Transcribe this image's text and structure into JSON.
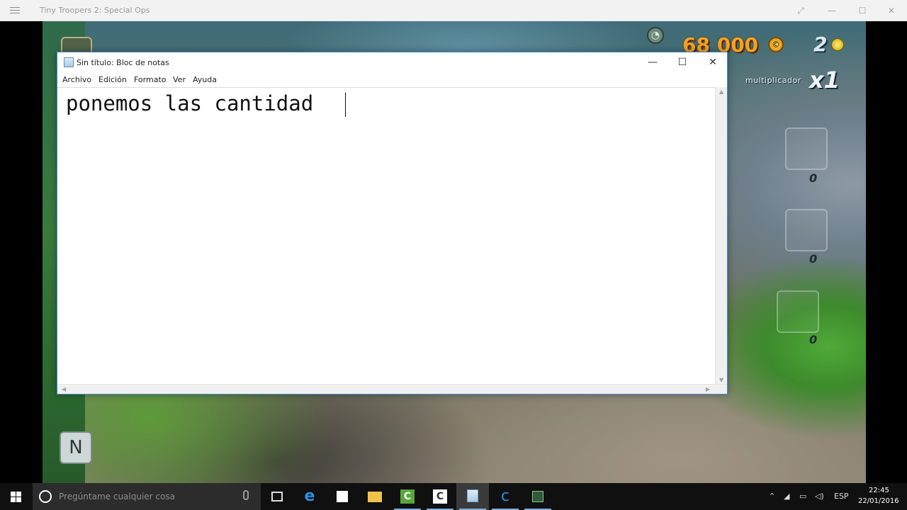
{
  "app_window": {
    "title": "Tiny Troopers 2: Special Ops",
    "minimize": "—",
    "maximize": "☐",
    "close": "✕"
  },
  "game_hud": {
    "money": "68 000",
    "coin_symbol": "©",
    "count": "2",
    "multiplier_label": "multiplicador",
    "multiplier_value": "x1",
    "slot_counts": [
      "0",
      "0",
      "0"
    ],
    "compass_symbol": "N"
  },
  "notepad": {
    "title": "Sin título: Bloc de notas",
    "menu": [
      "Archivo",
      "Edición",
      "Formato",
      "Ver",
      "Ayuda"
    ],
    "text": "ponemos las cantidad ",
    "minimize": "—",
    "maximize": "☐",
    "close": "✕"
  },
  "taskbar": {
    "search_placeholder": "Pregúntame cualquier cosa",
    "apps": [
      "task-view",
      "edge",
      "store",
      "file-explorer",
      "camtasia",
      "camtasia-recorder",
      "notepad",
      "ccleaner",
      "app"
    ],
    "language": "ESP",
    "time": "22:45",
    "date": "22/01/2016"
  },
  "colors": {
    "taskbar": "#101010",
    "search": "#2c2c2c",
    "notepad_border": "#3e8ad8",
    "hud_money": "#f3a224"
  }
}
